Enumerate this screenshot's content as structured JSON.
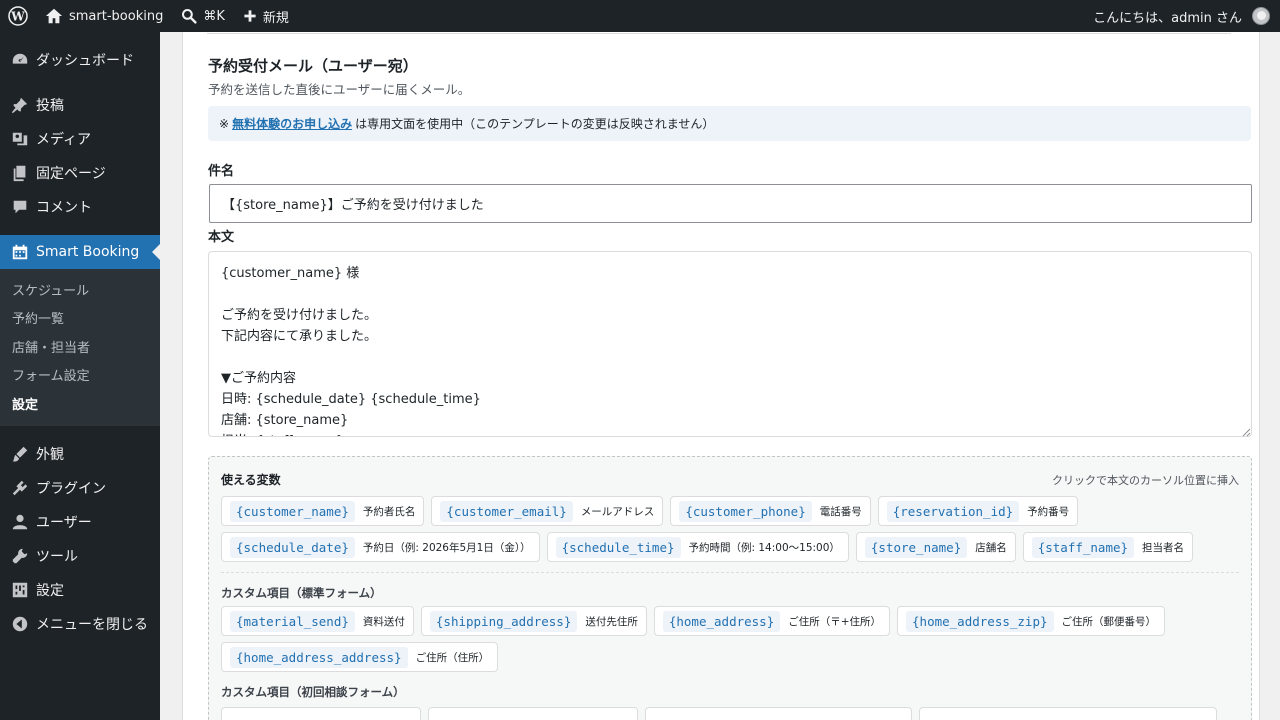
{
  "adminbar": {
    "site_name": "smart-booking",
    "search_shortcut": "⌘K",
    "new_label": "新規",
    "greeting": "こんにちは、admin さん"
  },
  "sidebar": {
    "items": [
      {
        "label": "ダッシュボード",
        "icon": "dashboard-icon"
      },
      {
        "label": "投稿",
        "icon": "pin-icon"
      },
      {
        "label": "メディア",
        "icon": "media-icon"
      },
      {
        "label": "固定ページ",
        "icon": "page-icon"
      },
      {
        "label": "コメント",
        "icon": "comment-icon"
      },
      {
        "label": "Smart Booking",
        "icon": "calendar-icon"
      },
      {
        "label": "外観",
        "icon": "brush-icon"
      },
      {
        "label": "プラグイン",
        "icon": "plugin-icon"
      },
      {
        "label": "ユーザー",
        "icon": "user-icon"
      },
      {
        "label": "ツール",
        "icon": "wrench-icon"
      },
      {
        "label": "設定",
        "icon": "settings-icon"
      },
      {
        "label": "メニューを閉じる",
        "icon": "collapse-icon"
      }
    ],
    "submenu": [
      "スケジュール",
      "予約一覧",
      "店舗・担当者",
      "フォーム設定",
      "設定"
    ]
  },
  "section": {
    "title": "予約受付メール（ユーザー宛）",
    "description": "予約を送信した直後にユーザーに届くメール。",
    "notice_prefix": "※",
    "notice_link": "無料体験のお申し込み",
    "notice_suffix": "は専用文面を使用中（このテンプレートの変更は反映されません）",
    "subject_label": "件名",
    "subject_value": "【{store_name}】ご予約を受け付けました",
    "body_label": "本文",
    "body_value": "{customer_name} 様\n\nご予約を受け付けました。\n下記内容にて承りました。\n\n▼ご予約内容\n日時: {schedule_date} {schedule_time}\n店舗: {store_name}\n担当: {staff_name}"
  },
  "variables": {
    "title": "使える変数",
    "hint": "クリックで本文のカーソル位置に挿入",
    "standard_row1": [
      {
        "code": "{customer_name}",
        "desc": "予約者氏名"
      },
      {
        "code": "{customer_email}",
        "desc": "メールアドレス"
      },
      {
        "code": "{customer_phone}",
        "desc": "電話番号"
      },
      {
        "code": "{reservation_id}",
        "desc": "予約番号"
      }
    ],
    "standard_row2": [
      {
        "code": "{schedule_date}",
        "desc": "予約日（例: 2026年5月1日（金））"
      },
      {
        "code": "{schedule_time}",
        "desc": "予約時間（例: 14:00〜15:00）"
      },
      {
        "code": "{store_name}",
        "desc": "店舗名"
      },
      {
        "code": "{staff_name}",
        "desc": "担当者名"
      }
    ],
    "custom_standard_title": "カスタム項目（標準フォーム）",
    "custom_row1": [
      {
        "code": "{material_send}",
        "desc": "資料送付"
      },
      {
        "code": "{shipping_address}",
        "desc": "送付先住所"
      },
      {
        "code": "{home_address}",
        "desc": "ご住所（〒+住所）"
      },
      {
        "code": "{home_address_zip}",
        "desc": "ご住所（郵便番号）"
      }
    ],
    "custom_row2": [
      {
        "code": "{home_address_address}",
        "desc": "ご住所（住所）"
      }
    ],
    "custom_consult_title": "カスタム項目（初回相談フォーム）"
  },
  "colors": {
    "accent": "#2271b1",
    "adminbar_bg": "#1d2327"
  }
}
